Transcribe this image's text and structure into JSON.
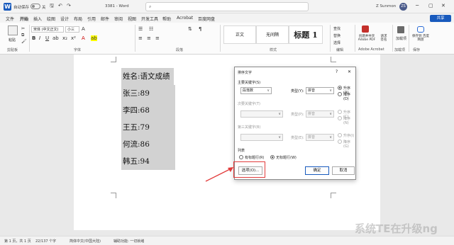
{
  "titlebar": {
    "autosave": "自动保存",
    "toggle": "关",
    "doc_title": "3381 - Word",
    "user": "Z Sunmon",
    "user_initials": "ZS"
  },
  "menu": {
    "tabs": [
      "文件",
      "开始",
      "插入",
      "绘图",
      "设计",
      "布局",
      "引用",
      "邮件",
      "审阅",
      "视图",
      "开发工具",
      "帮助",
      "Acrobat",
      "百度网盘"
    ],
    "active_index": 1,
    "share": "共享"
  },
  "ribbon": {
    "paste": "粘贴",
    "font_name": "宋体 (中文正文)",
    "font_size": "小三",
    "font_size_num": "A",
    "style_normal": "正文",
    "style_nospace": "无间隔",
    "style_heading": "标题 1",
    "find": "查找",
    "replace": "替换",
    "select": "选择",
    "create_pdf": "创建并共享 Adobe PDF",
    "request_sign": "请求签名",
    "addins": "加载项",
    "baidu_save": "保存到 百度网盘",
    "groups": [
      "剪贴板",
      "字体",
      "段落",
      "样式",
      "编辑",
      "Adobe Acrobat",
      "加载项",
      "保存"
    ]
  },
  "document": {
    "lines": [
      "姓名:语文成绩",
      "张三:89",
      "李四:68",
      "王五:79",
      "何流:86",
      "韩五:94"
    ]
  },
  "dialog": {
    "title": "排序文字",
    "help": "?",
    "close": "✕",
    "key1_label": "主要关键字(S)",
    "key1_value": "段落数",
    "type_label": "类型(Y):",
    "type_value": "拼音",
    "asc": "升序(A)",
    "desc": "降序(D)",
    "key2_label": "次要关键字(T)",
    "type2_label": "类型(P):",
    "type2_value": "拼音",
    "asc2": "升序(C)",
    "desc2": "降序(N)",
    "key3_label": "第三关键字(B)",
    "type3_label": "类型(E):",
    "type3_value": "拼音",
    "asc3": "升序(I)",
    "desc3": "降序(G)",
    "list_label": "列表",
    "has_header": "有标题行(R)",
    "no_header": "无标题行(W)",
    "options": "选项(O)...",
    "ok": "确定",
    "cancel": "取消"
  },
  "statusbar": {
    "page": "第 1 页，共 1 页",
    "words": "22/137 个字",
    "language": "简体中文(中国大陆)",
    "accessibility": "辅助功能: 一切就绪"
  },
  "watermark": "系统TE在升级ng",
  "colors": {
    "accent": "#185abd",
    "annotation": "#e23b3b"
  }
}
